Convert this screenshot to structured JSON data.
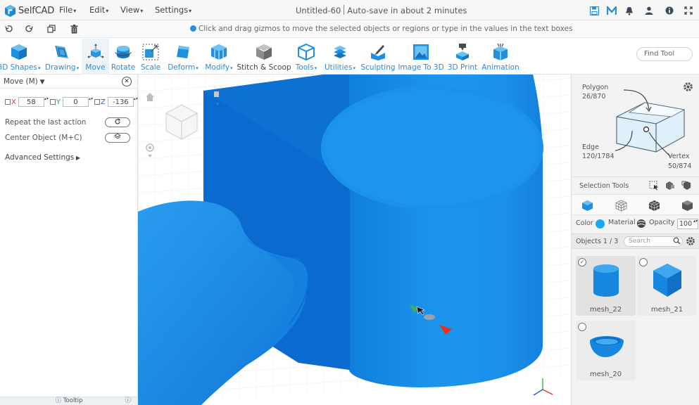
{
  "app": {
    "name": "SelfCAD"
  },
  "menus": [
    "File",
    "Edit",
    "View",
    "Settings"
  ],
  "document": {
    "title": "Untitled-60",
    "autosave": "Auto-save in about 2 minutes"
  },
  "hint": "Click and drag gizmos to move the selected objects or regions or type in the values in the text boxes",
  "toolbar": [
    {
      "label": "3D Shapes",
      "icon": "cube-icon",
      "dropdown": true
    },
    {
      "label": "Drawing",
      "icon": "drawing-icon",
      "dropdown": true
    },
    {
      "label": "Move",
      "icon": "move-icon",
      "dropdown": false,
      "active": true
    },
    {
      "label": "Rotate",
      "icon": "rotate-icon",
      "dropdown": false
    },
    {
      "label": "Scale",
      "icon": "scale-icon",
      "dropdown": false
    },
    {
      "label": "Deform",
      "icon": "deform-icon",
      "dropdown": true
    },
    {
      "label": "Modify",
      "icon": "modify-icon",
      "dropdown": true
    },
    {
      "label": "Stitch & Scoop",
      "icon": "stitch-scoop-icon",
      "dropdown": false,
      "dark": true
    },
    {
      "label": "Tools",
      "icon": "tools-icon",
      "dropdown": true
    },
    {
      "label": "Utilities",
      "icon": "utilities-icon",
      "dropdown": true
    },
    {
      "label": "Sculpting",
      "icon": "sculpting-icon",
      "dropdown": false
    },
    {
      "label": "Image To 3D",
      "icon": "image-to-3d-icon",
      "dropdown": false
    },
    {
      "label": "3D Print",
      "icon": "3d-print-icon",
      "dropdown": false
    },
    {
      "label": "Animation",
      "icon": "animation-icon",
      "dropdown": false
    }
  ],
  "find_tool": {
    "label": "Find Tool"
  },
  "move_panel": {
    "title": "Move (M)",
    "x": {
      "label": "X",
      "value": "58"
    },
    "y": {
      "label": "Y",
      "value": "0"
    },
    "z": {
      "label": "Z",
      "value": "-136"
    },
    "repeat": "Repeat the last action",
    "center": "Center Object (M+C)",
    "advanced": "Advanced Settings",
    "tooltip": "Tooltip"
  },
  "selection": {
    "polygon": {
      "label": "Polygon",
      "count": "26/870"
    },
    "edge": {
      "label": "Edge",
      "count": "120/1784"
    },
    "vertex": {
      "label": "Vertex",
      "count": "50/874"
    },
    "tools_label": "Selection Tools"
  },
  "appearance": {
    "color_label": "Color",
    "color": "#1ea7ee",
    "material_label": "Material",
    "opacity_label": "Opacity",
    "opacity": "100"
  },
  "objects": {
    "header": "Objects 1 / 3",
    "search_placeholder": "Search",
    "items": [
      {
        "name": "mesh_22",
        "selected": true
      },
      {
        "name": "mesh_21",
        "selected": false
      },
      {
        "name": "mesh_20",
        "selected": false
      }
    ]
  }
}
